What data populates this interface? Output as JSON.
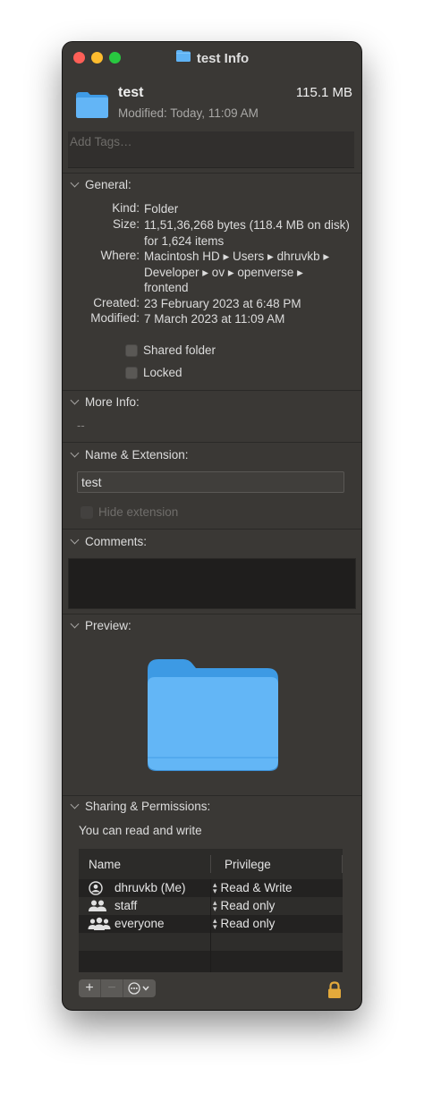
{
  "window": {
    "title": "test Info"
  },
  "header": {
    "name": "test",
    "size": "115.1 MB",
    "modified": "Modified: Today, 11:09 AM"
  },
  "tags": {
    "placeholder": "Add Tags…"
  },
  "general": {
    "heading": "General:",
    "rows": [
      {
        "label": "Kind:",
        "value": "Folder"
      },
      {
        "label": "Size:",
        "value": "11,51,36,268 bytes (118.4 MB on disk) for 1,624 items"
      },
      {
        "label": "Where:",
        "value": "Macintosh HD ▸ Users ▸ dhruvkb ▸ Developer ▸ ov ▸ openverse ▸ frontend"
      },
      {
        "label": "Created:",
        "value": "23 February 2023 at 6:48 PM"
      },
      {
        "label": "Modified:",
        "value": "7 March 2023 at 11:09 AM"
      }
    ],
    "shared_folder": "Shared folder",
    "locked": "Locked"
  },
  "more_info": {
    "heading": "More Info:",
    "value": "--"
  },
  "name_extension": {
    "heading": "Name & Extension:",
    "name_value": "test",
    "hide_extension": "Hide extension"
  },
  "comments": {
    "heading": "Comments:"
  },
  "preview": {
    "heading": "Preview:"
  },
  "sharing": {
    "heading": "Sharing & Permissions:",
    "summary": "You can read and write",
    "columns": {
      "name": "Name",
      "privilege": "Privilege"
    },
    "rows": [
      {
        "name": "dhruvkb (Me)",
        "privilege": "Read & Write",
        "icon": "user-icon"
      },
      {
        "name": "staff",
        "privilege": "Read only",
        "icon": "group-icon"
      },
      {
        "name": "everyone",
        "privilege": "Read only",
        "icon": "everyone-icon"
      }
    ],
    "buttons": {
      "add": "+",
      "remove": "−"
    }
  },
  "colors": {
    "window_bg": "#3a3835",
    "folder_blue": "#5fb3f5",
    "lock_gold": "#e3a93b"
  }
}
